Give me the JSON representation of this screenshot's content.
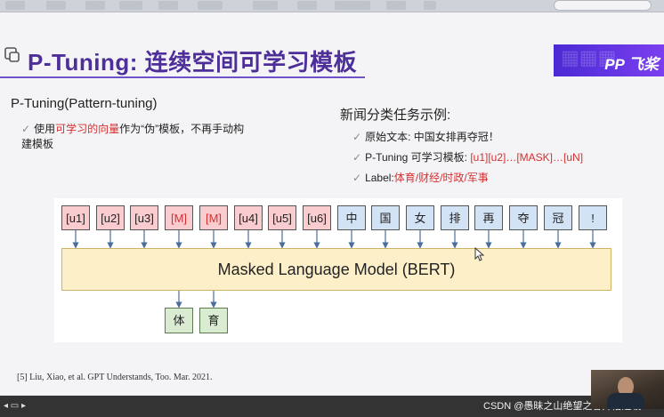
{
  "slide": {
    "title": "P-Tuning: 连续空间可学习模板",
    "brand_text": "飞桨",
    "brand_mark": "PP",
    "left": {
      "heading": "P-Tuning(Pattern-tuning)",
      "bullet_prefix": "使用",
      "bullet_highlight": "可学习的向量",
      "bullet_suffix": "作为“伪”模板，不再手动构建模板"
    },
    "right": {
      "heading": "新闻分类任务示例:",
      "original_label": "原始文本: 中国女排再夺冠！",
      "template_label": "P-Tuning 可学习模板: ",
      "template_value": "[u1][u2]…[MASK]…[uN]",
      "label_prefix": "Label:",
      "label_value": "体育/财经/时政/军事"
    },
    "diagram": {
      "tokens": [
        {
          "text": "[u1]",
          "kind": "u"
        },
        {
          "text": "[u2]",
          "kind": "u"
        },
        {
          "text": "[u3]",
          "kind": "u"
        },
        {
          "text": "[M]",
          "kind": "m"
        },
        {
          "text": "[M]",
          "kind": "m"
        },
        {
          "text": "[u4]",
          "kind": "u"
        },
        {
          "text": "[u5]",
          "kind": "u"
        },
        {
          "text": "[u6]",
          "kind": "u"
        },
        {
          "text": "中",
          "kind": "c"
        },
        {
          "text": "国",
          "kind": "c"
        },
        {
          "text": "女",
          "kind": "c"
        },
        {
          "text": "排",
          "kind": "c"
        },
        {
          "text": "再",
          "kind": "c"
        },
        {
          "text": "夺",
          "kind": "c"
        },
        {
          "text": "冠",
          "kind": "c"
        },
        {
          "text": "!",
          "kind": "c"
        }
      ],
      "model_label": "Masked Language Model (BERT)",
      "outputs": [
        "体",
        "育"
      ]
    },
    "citation": "[5] Liu, Xiao, et al. GPT Understands, Too. Mar. 2021."
  },
  "watermark": "CSDN @愚昧之山绝望之谷开悟之坡",
  "colors": {
    "title": "#4e2f9a",
    "accent_red": "#d43030",
    "brand_gradient_start": "#4b2ad3",
    "token_pink": "#f9ccd0",
    "token_blue": "#d3e3f6",
    "model_yellow": "#fdf0c8",
    "output_green": "#d9ecd2"
  }
}
